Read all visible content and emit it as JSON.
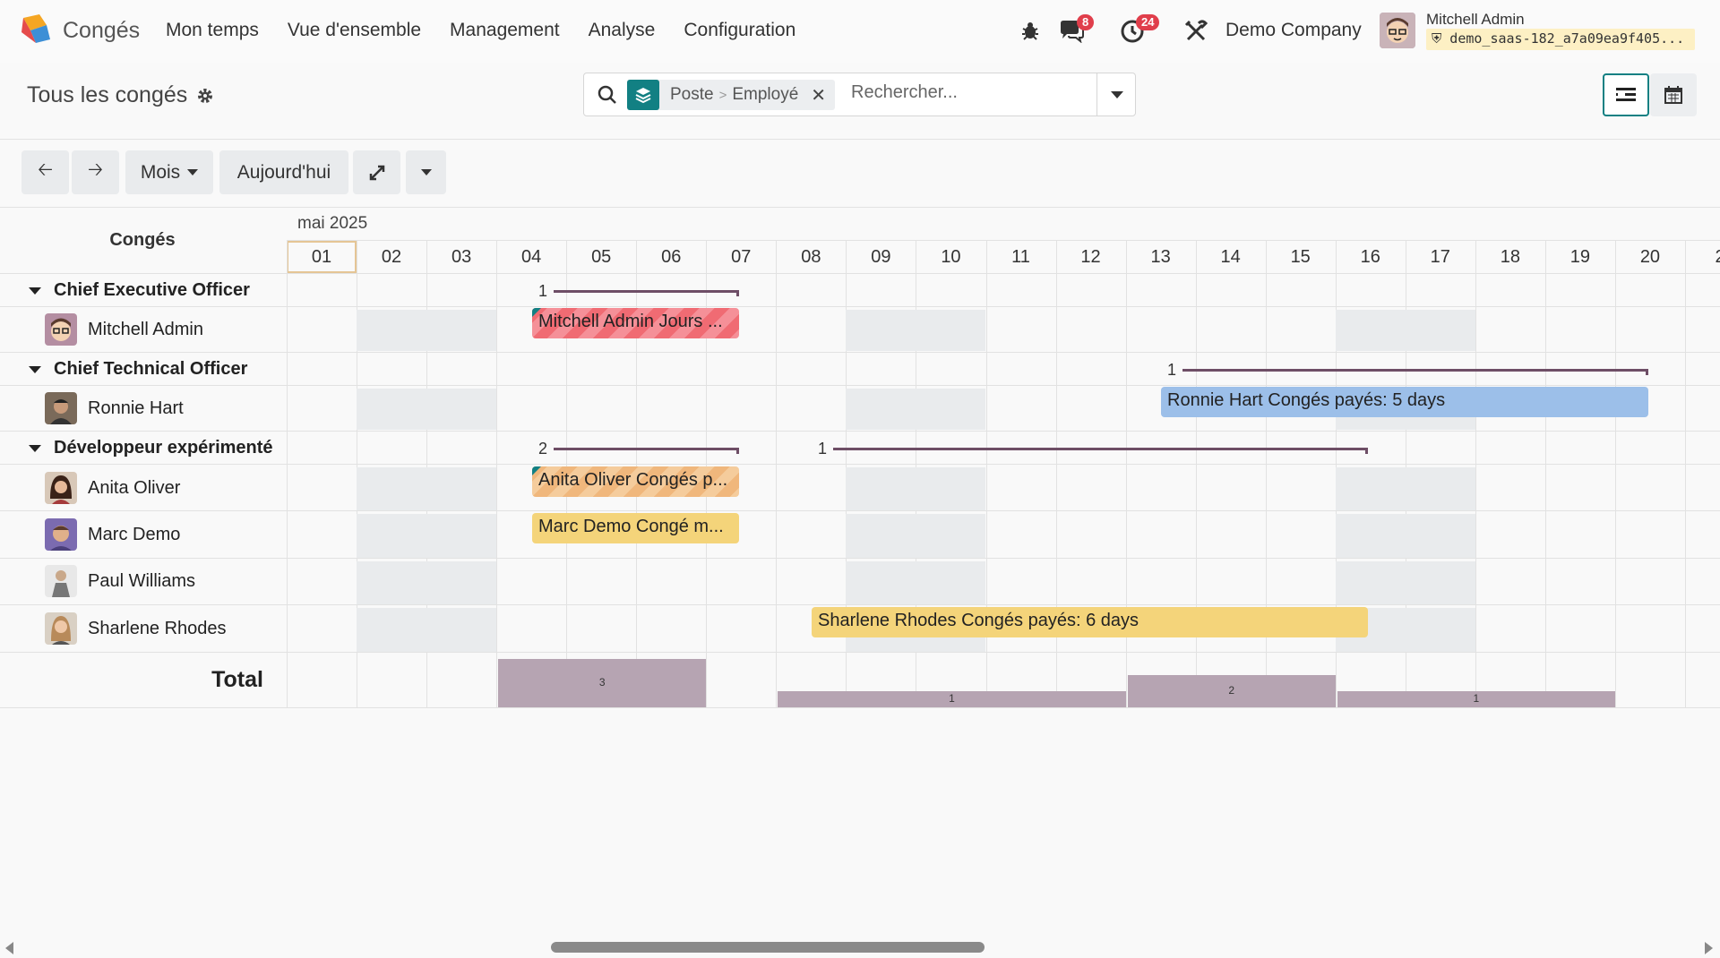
{
  "navbar": {
    "app_name": "Congés",
    "menu": [
      "Mon temps",
      "Vue d'ensemble",
      "Management",
      "Analyse",
      "Configuration"
    ],
    "messages_count": "8",
    "activities_count": "24",
    "company": "Demo Company",
    "user_name": "Mitchell Admin",
    "db_name": "demo_saas-182_a7a09ea9f405..."
  },
  "control_panel": {
    "title": "Tous les congés",
    "facet_parts": [
      "Poste",
      "Employé"
    ],
    "search_placeholder": "Rechercher..."
  },
  "toolbar": {
    "scale_label": "Mois",
    "today_label": "Aujourd'hui"
  },
  "gantt": {
    "column_title": "Congés",
    "month_label": "mai 2025",
    "days": [
      "01",
      "02",
      "03",
      "04",
      "05",
      "06",
      "07",
      "08",
      "09",
      "10",
      "11",
      "12",
      "13",
      "14",
      "15",
      "16",
      "17",
      "18",
      "19",
      "20",
      "2"
    ],
    "groups": [
      {
        "name": "Chief Executive Officer",
        "summaries": [
          {
            "count": "1"
          }
        ],
        "employees": [
          {
            "name": "Mitchell Admin",
            "bar_text": "Mitchell Admin Jours ..."
          }
        ]
      },
      {
        "name": "Chief Technical Officer",
        "summaries": [
          {
            "count": "1"
          }
        ],
        "employees": [
          {
            "name": "Ronnie Hart",
            "bar_text": "Ronnie Hart Congés payés: 5 days"
          }
        ]
      },
      {
        "name": "Développeur expérimenté",
        "summaries": [
          {
            "count": "2"
          },
          {
            "count": "1"
          }
        ],
        "employees": [
          {
            "name": "Anita Oliver",
            "bar_text": "Anita Oliver Congés p..."
          },
          {
            "name": "Marc Demo",
            "bar_text": "Marc Demo Congé m..."
          },
          {
            "name": "Paul Williams",
            "bar_text": ""
          },
          {
            "name": "Sharlene Rhodes",
            "bar_text": "Sharlene Rhodes Congés payés: 6 days"
          }
        ]
      }
    ],
    "total_label": "Total",
    "totals": [
      {
        "from_day": 4,
        "to_day": 7,
        "value": 3
      },
      {
        "from_day": 8,
        "to_day": 13,
        "value": 1
      },
      {
        "from_day": 13,
        "to_day": 16,
        "value": 2
      },
      {
        "from_day": 16,
        "to_day": 20,
        "value": 1
      }
    ],
    "total_max": 3
  },
  "colors": {
    "accent": "#128083",
    "badge": "#e03e4b",
    "bar_red": "#f06b73",
    "bar_blue": "#9cbfe9",
    "bar_orange": "#f0b77c",
    "bar_yellow": "#f4d47a",
    "total_bar": "#b6a4b2"
  }
}
